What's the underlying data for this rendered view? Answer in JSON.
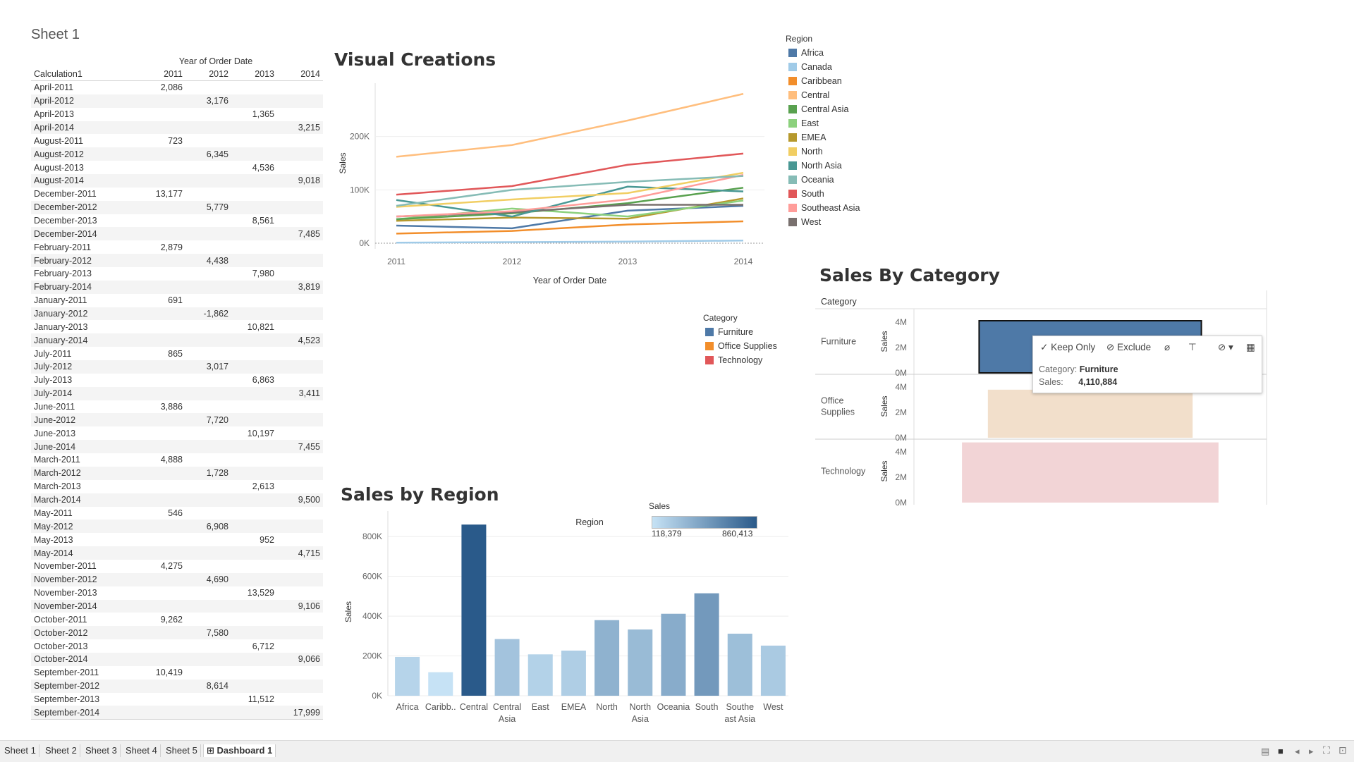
{
  "sheet1": {
    "title": "Sheet 1",
    "col_header_title": "Year of Order Date",
    "row_header": "Calculation1",
    "years": [
      "2011",
      "2012",
      "2013",
      "2014"
    ],
    "rows": [
      {
        "label": "April-2011",
        "col": 0,
        "value": "2,086"
      },
      {
        "label": "April-2012",
        "col": 1,
        "value": "3,176"
      },
      {
        "label": "April-2013",
        "col": 2,
        "value": "1,365"
      },
      {
        "label": "April-2014",
        "col": 3,
        "value": "3,215"
      },
      {
        "label": "August-2011",
        "col": 0,
        "value": "723"
      },
      {
        "label": "August-2012",
        "col": 1,
        "value": "6,345"
      },
      {
        "label": "August-2013",
        "col": 2,
        "value": "4,536"
      },
      {
        "label": "August-2014",
        "col": 3,
        "value": "9,018"
      },
      {
        "label": "December-2011",
        "col": 0,
        "value": "13,177"
      },
      {
        "label": "December-2012",
        "col": 1,
        "value": "5,779"
      },
      {
        "label": "December-2013",
        "col": 2,
        "value": "8,561"
      },
      {
        "label": "December-2014",
        "col": 3,
        "value": "7,485"
      },
      {
        "label": "February-2011",
        "col": 0,
        "value": "2,879"
      },
      {
        "label": "February-2012",
        "col": 1,
        "value": "4,438"
      },
      {
        "label": "February-2013",
        "col": 2,
        "value": "7,980"
      },
      {
        "label": "February-2014",
        "col": 3,
        "value": "3,819"
      },
      {
        "label": "January-2011",
        "col": 0,
        "value": "691"
      },
      {
        "label": "January-2012",
        "col": 1,
        "value": "-1,862"
      },
      {
        "label": "January-2013",
        "col": 2,
        "value": "10,821"
      },
      {
        "label": "January-2014",
        "col": 3,
        "value": "4,523"
      },
      {
        "label": "July-2011",
        "col": 0,
        "value": "865"
      },
      {
        "label": "July-2012",
        "col": 1,
        "value": "3,017"
      },
      {
        "label": "July-2013",
        "col": 2,
        "value": "6,863"
      },
      {
        "label": "July-2014",
        "col": 3,
        "value": "3,411"
      },
      {
        "label": "June-2011",
        "col": 0,
        "value": "3,886"
      },
      {
        "label": "June-2012",
        "col": 1,
        "value": "7,720"
      },
      {
        "label": "June-2013",
        "col": 2,
        "value": "10,197"
      },
      {
        "label": "June-2014",
        "col": 3,
        "value": "7,455"
      },
      {
        "label": "March-2011",
        "col": 0,
        "value": "4,888"
      },
      {
        "label": "March-2012",
        "col": 1,
        "value": "1,728"
      },
      {
        "label": "March-2013",
        "col": 2,
        "value": "2,613"
      },
      {
        "label": "March-2014",
        "col": 3,
        "value": "9,500"
      },
      {
        "label": "May-2011",
        "col": 0,
        "value": "546"
      },
      {
        "label": "May-2012",
        "col": 1,
        "value": "6,908"
      },
      {
        "label": "May-2013",
        "col": 2,
        "value": "952"
      },
      {
        "label": "May-2014",
        "col": 3,
        "value": "4,715"
      },
      {
        "label": "November-2011",
        "col": 0,
        "value": "4,275"
      },
      {
        "label": "November-2012",
        "col": 1,
        "value": "4,690"
      },
      {
        "label": "November-2013",
        "col": 2,
        "value": "13,529"
      },
      {
        "label": "November-2014",
        "col": 3,
        "value": "9,106"
      },
      {
        "label": "October-2011",
        "col": 0,
        "value": "9,262"
      },
      {
        "label": "October-2012",
        "col": 1,
        "value": "7,580"
      },
      {
        "label": "October-2013",
        "col": 2,
        "value": "6,712"
      },
      {
        "label": "October-2014",
        "col": 3,
        "value": "9,066"
      },
      {
        "label": "September-2011",
        "col": 0,
        "value": "10,419"
      },
      {
        "label": "September-2012",
        "col": 1,
        "value": "8,614"
      },
      {
        "label": "September-2013",
        "col": 2,
        "value": "11,512"
      },
      {
        "label": "September-2014",
        "col": 3,
        "value": "17,999"
      }
    ]
  },
  "region_legend": {
    "title": "Region",
    "items": [
      {
        "name": "Africa",
        "color": "#4e79a7"
      },
      {
        "name": "Canada",
        "color": "#a0cbe8"
      },
      {
        "name": "Caribbean",
        "color": "#f28e2b"
      },
      {
        "name": "Central",
        "color": "#ffbe7d"
      },
      {
        "name": "Central Asia",
        "color": "#59a14f"
      },
      {
        "name": "East",
        "color": "#8cd17d"
      },
      {
        "name": "EMEA",
        "color": "#b6992d"
      },
      {
        "name": "North",
        "color": "#f1ce63"
      },
      {
        "name": "North Asia",
        "color": "#499894"
      },
      {
        "name": "Oceania",
        "color": "#86bcb6"
      },
      {
        "name": "South",
        "color": "#e15759"
      },
      {
        "name": "Southeast Asia",
        "color": "#ff9d9a"
      },
      {
        "name": "West",
        "color": "#79706e"
      }
    ]
  },
  "category_legend": {
    "title": "Category",
    "items": [
      {
        "name": "Furniture",
        "color": "#4e79a7"
      },
      {
        "name": "Office Supplies",
        "color": "#f28e2b"
      },
      {
        "name": "Technology",
        "color": "#e15759"
      }
    ]
  },
  "sales_legend": {
    "title": "Sales",
    "min": "118,379",
    "max": "860,413",
    "color_low": "#c6e2f5",
    "color_high": "#2a5a8a"
  },
  "tooltip": {
    "keep_only": "Keep Only",
    "exclude": "Exclude",
    "category_label": "Category:",
    "category_value": "Furniture",
    "sales_label": "Sales:",
    "sales_value": "4,110,884"
  },
  "tabs": [
    "Sheet 1",
    "Sheet 2",
    "Sheet 3",
    "Sheet 4",
    "Sheet 5",
    "Dashboard 1"
  ],
  "chart_data": [
    {
      "type": "line",
      "title": "Visual Creations",
      "xlabel": "Year of Order Date",
      "ylabel": "Sales",
      "x": [
        "2011",
        "2012",
        "2013",
        "2014"
      ],
      "yticks": [
        "0K",
        "100K",
        "200K"
      ],
      "ylim": [
        0,
        300000
      ],
      "grid": true,
      "series": [
        {
          "name": "Central",
          "color": "#ffbe7d",
          "values": [
            162000,
            184000,
            230000,
            280000
          ]
        },
        {
          "name": "South",
          "color": "#e15759",
          "values": [
            91000,
            107000,
            147000,
            168000
          ]
        },
        {
          "name": "Oceania",
          "color": "#86bcb6",
          "values": [
            70000,
            100000,
            115000,
            126000
          ]
        },
        {
          "name": "North",
          "color": "#f1ce63",
          "values": [
            68000,
            82000,
            94000,
            132000
          ]
        },
        {
          "name": "Southeast Asia",
          "color": "#ff9d9a",
          "values": [
            50000,
            60000,
            82000,
            128000
          ]
        },
        {
          "name": "North Asia",
          "color": "#499894",
          "values": [
            81000,
            50000,
            106000,
            97000
          ]
        },
        {
          "name": "West",
          "color": "#79706e",
          "values": [
            50000,
            58000,
            72000,
            72000
          ]
        },
        {
          "name": "Central Asia",
          "color": "#59a14f",
          "values": [
            45000,
            56000,
            75000,
            104000
          ]
        },
        {
          "name": "East",
          "color": "#8cd17d",
          "values": [
            45000,
            65000,
            50000,
            80000
          ]
        },
        {
          "name": "EMEA",
          "color": "#b6992d",
          "values": [
            42000,
            48000,
            46000,
            84000
          ]
        },
        {
          "name": "Africa",
          "color": "#4e79a7",
          "values": [
            33000,
            28000,
            61000,
            70000
          ]
        },
        {
          "name": "Caribbean",
          "color": "#f28e2b",
          "values": [
            18000,
            23000,
            35000,
            41000
          ]
        },
        {
          "name": "Canada",
          "color": "#a0cbe8",
          "values": [
            1000,
            2000,
            3000,
            5000
          ]
        }
      ]
    },
    {
      "type": "bar",
      "title": "Sales by Region",
      "xlabel": "Region",
      "ylabel": "Sales",
      "categories": [
        "Africa",
        "Caribb..",
        "Central",
        "Central Asia",
        "East",
        "EMEA",
        "North",
        "North Asia",
        "Oceania",
        "South",
        "Southeast Asia",
        "West"
      ],
      "category_display": [
        [
          "Africa"
        ],
        [
          "Caribb.."
        ],
        [
          "Central"
        ],
        [
          "Central",
          "Asia"
        ],
        [
          "East"
        ],
        [
          "EMEA"
        ],
        [
          "North"
        ],
        [
          "North",
          "Asia"
        ],
        [
          "Oceania"
        ],
        [
          "South"
        ],
        [
          "Southe",
          "ast Asia"
        ],
        [
          "West"
        ]
      ],
      "values": [
        195000,
        118379,
        860413,
        285000,
        208000,
        227000,
        380000,
        333000,
        412000,
        515000,
        312000,
        252000
      ],
      "yticks": [
        "0K",
        "200K",
        "400K",
        "600K",
        "800K"
      ],
      "ylim": [
        0,
        900000
      ],
      "color_range": [
        "#c6e2f5",
        "#2a5a8a"
      ]
    },
    {
      "type": "bar",
      "title": "Sales By Category",
      "row_header": "Category",
      "ylabel": "Sales",
      "categories": [
        "Furniture",
        "Office Supplies",
        "Technology"
      ],
      "category_display": [
        [
          "Furniture"
        ],
        [
          "Office",
          "Supplies"
        ],
        [
          "Technology"
        ]
      ],
      "values": [
        4110884,
        3787070,
        4744557
      ],
      "colors": [
        "#4e79a7",
        "#f2dfcb",
        "#f2d4d6"
      ],
      "yticks": [
        "0M",
        "2M",
        "4M"
      ],
      "ylim": [
        0,
        4500000
      ],
      "selected": "Furniture"
    }
  ]
}
